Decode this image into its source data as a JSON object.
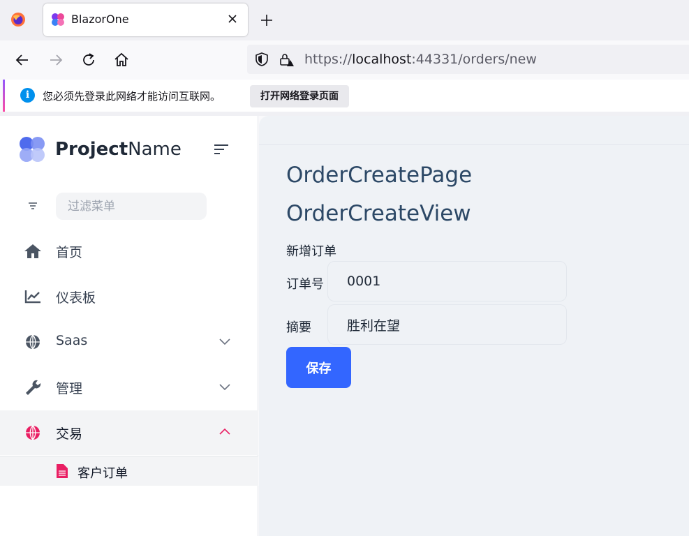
{
  "browser": {
    "tab": {
      "title": "BlazorOne"
    },
    "url": {
      "scheme": "https://",
      "host": "localhost",
      "rest": ":44331/orders/new"
    },
    "infobar": {
      "message": "您必须先登录此网络才能访问互联网。",
      "button": "打开网络登录页面"
    }
  },
  "app": {
    "brand": {
      "bold": "Project",
      "regular": "Name"
    },
    "filter": {
      "placeholder": "过滤菜单"
    },
    "menu": [
      {
        "label": "首页",
        "icon": "home-icon"
      },
      {
        "label": "仪表板",
        "icon": "chart-line-icon"
      },
      {
        "label": "Saas",
        "icon": "globe-icon",
        "chevron": "chevron-down-icon"
      },
      {
        "label": "管理",
        "icon": "wrench-icon",
        "chevron": "chevron-down-icon"
      },
      {
        "label": "交易",
        "icon": "globe-icon",
        "chevron": "chevron-up-icon"
      }
    ],
    "submenu": [
      {
        "label": "客户订单",
        "icon": "file-icon"
      }
    ],
    "colors": {
      "accent_pink": "#e91e63",
      "primary_button": "#3366ff",
      "heading": "#2c4866"
    }
  },
  "page": {
    "title1": "OrderCreatePage",
    "title2": "OrderCreateView",
    "form_title": "新增订单",
    "fields": [
      {
        "label": "订单号",
        "value": "0001"
      },
      {
        "label": "摘要",
        "value": "胜利在望"
      }
    ],
    "save_label": "保存"
  }
}
